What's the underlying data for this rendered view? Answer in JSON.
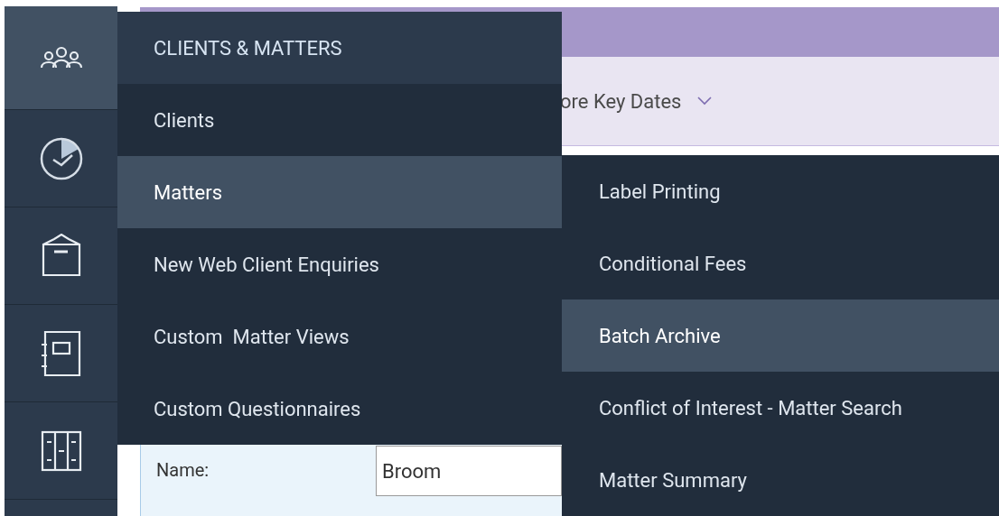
{
  "rail": [
    {
      "kind": "people",
      "selected": true
    },
    {
      "kind": "clock",
      "selected": false
    },
    {
      "kind": "box",
      "selected": false
    },
    {
      "kind": "notebook",
      "selected": false
    },
    {
      "kind": "columns",
      "selected": false
    }
  ],
  "background": {
    "toolbar_item": "ore Key Dates",
    "form": {
      "label": "Name:",
      "value": "Broom"
    }
  },
  "menu": {
    "title": "CLIENTS & MATTERS",
    "items": [
      {
        "label": "Clients",
        "selected": false
      },
      {
        "label": "Matters",
        "selected": true
      },
      {
        "label": "New Web Client Enquiries",
        "selected": false
      },
      {
        "label": "Custom  Matter Views",
        "selected": false
      },
      {
        "label": "Custom Questionnaires",
        "selected": false
      }
    ]
  },
  "submenu": {
    "items": [
      {
        "label": "Label Printing",
        "selected": false
      },
      {
        "label": "Conditional Fees",
        "selected": false
      },
      {
        "label": "Batch Archive",
        "selected": true
      },
      {
        "label": "Conflict of Interest - Matter Search",
        "selected": false
      },
      {
        "label": "Matter Summary",
        "selected": false
      }
    ]
  }
}
